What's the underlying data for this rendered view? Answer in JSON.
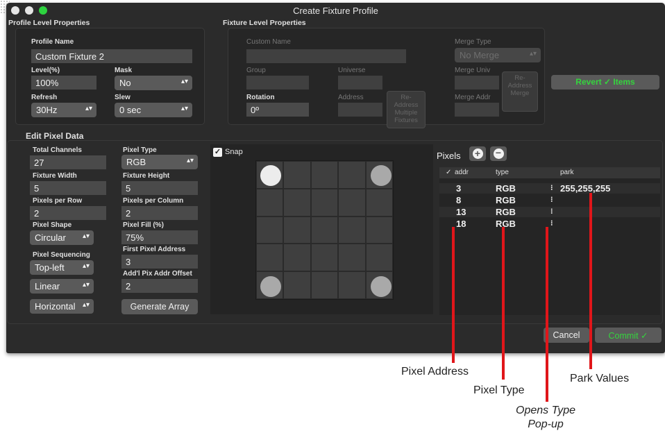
{
  "window": {
    "title": "Create Fixture Profile"
  },
  "traffic_colors": {
    "close": "#e5e5e5",
    "minimize": "#e5e5e5",
    "zoom": "#2dd33f"
  },
  "profile": {
    "group_title": "Profile Level Properties",
    "name_label": "Profile Name",
    "name_value": "Custom Fixture 2",
    "level_label": "Level(%)",
    "level_value": "100%",
    "mask_label": "Mask",
    "mask_value": "No",
    "refresh_label": "Refresh",
    "refresh_value": "30Hz",
    "slew_label": "Slew",
    "slew_value": "0 sec"
  },
  "fixture": {
    "group_title": "Fixture Level Properties",
    "custom_name_label": "Custom Name",
    "merge_type_label": "Merge Type",
    "merge_type_value": "No Merge",
    "group_label": "Group",
    "universe_label": "Universe",
    "readdress_button": [
      "Re-",
      "Address",
      "Multiple",
      "Fixtures"
    ],
    "merge_univ_label": "Merge Univ",
    "remerge_button": [
      "Re-",
      "Address",
      "Merge"
    ],
    "rotation_label": "Rotation",
    "rotation_value": "0º",
    "address_label": "Address",
    "merge_addr_label": "Merge Addr"
  },
  "revert_button": "Revert ✓ Items",
  "pixel_edit": {
    "group_title": "Edit Pixel Data",
    "total_channels_label": "Total Channels",
    "total_channels_value": "27",
    "pixel_type_label": "Pixel Type",
    "pixel_type_value": "RGB",
    "fixture_width_label": "Fixture Width",
    "fixture_width_value": "5",
    "fixture_height_label": "Fixture Height",
    "fixture_height_value": "5",
    "pixels_per_row_label": "Pixels per Row",
    "pixels_per_row_value": "2",
    "pixels_per_column_label": "Pixels per Column",
    "pixels_per_column_value": "2",
    "pixel_shape_label": "Pixel Shape",
    "pixel_shape_value": "Circular",
    "pixel_fill_label": "Pixel Fill (%)",
    "pixel_fill_value": "75%",
    "pixel_sequencing_label": "Pixel Sequencing",
    "pixel_sequencing_value": "Top-left",
    "first_pixel_address_label": "First Pixel Address",
    "first_pixel_address_value": "3",
    "linear_value": "Linear",
    "addl_pix_offset_label": "Add'l Pix Addr Offset",
    "addl_pix_offset_value": "2",
    "direction_value": "Horizontal",
    "generate_button": "Generate Array"
  },
  "snap": {
    "label": "Snap",
    "checked": true
  },
  "pixel_grid": {
    "columns": 5,
    "rows": 5,
    "circle_colors": [
      "#ececec",
      "#a9a9a9",
      "#a9a9a9",
      "#a9a9a9"
    ]
  },
  "pixels": {
    "title": "Pixels",
    "add_icon": "plus-circle-icon",
    "remove_icon": "minus-circle-icon",
    "headers": {
      "check": "✓",
      "addr": "addr",
      "type": "type",
      "park": "park"
    },
    "rows": [
      {
        "addr": "3",
        "type": "RGB",
        "park": "255,255,255"
      },
      {
        "addr": "8",
        "type": "RGB",
        "park": ""
      },
      {
        "addr": "13",
        "type": "RGB",
        "park": ""
      },
      {
        "addr": "18",
        "type": "RGB",
        "park": ""
      }
    ]
  },
  "footer": {
    "cancel": "Cancel",
    "commit": "Commit ✓"
  },
  "annotations": {
    "pixel_address": "Pixel Address",
    "pixel_type": "Pixel Type",
    "opens_type_line1": "Opens Type",
    "opens_type_line2": "Pop-up",
    "park_values": "Park Values",
    "color": "#e0161a"
  }
}
